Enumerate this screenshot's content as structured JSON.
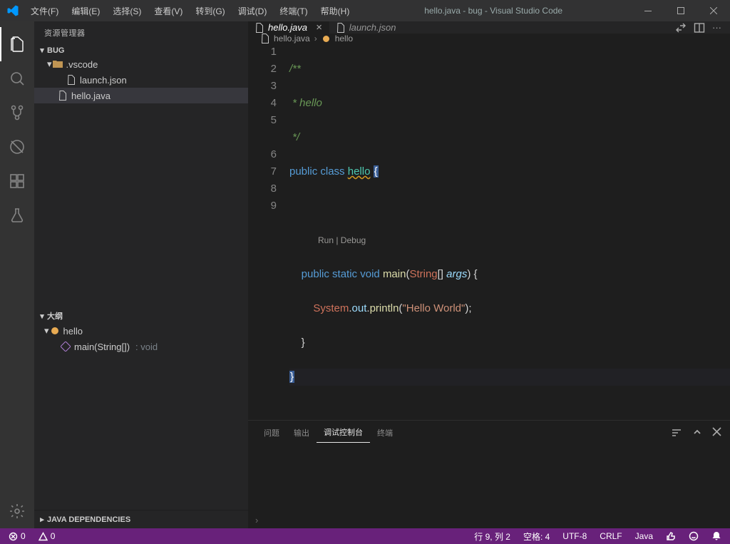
{
  "menu": [
    "文件(F)",
    "编辑(E)",
    "选择(S)",
    "查看(V)",
    "转到(G)",
    "调试(D)",
    "终端(T)",
    "帮助(H)"
  ],
  "title": "hello.java - bug - Visual Studio Code",
  "sidebar": {
    "title": "资源管理器",
    "project": "BUG",
    "folder": ".vscode",
    "files": [
      "launch.json",
      "hello.java"
    ],
    "outlineTitle": "大纲",
    "outlineClass": "hello",
    "outlineMethod": "main(String[])",
    "outlineReturn": ": void",
    "javaDeps": "JAVA DEPENDENCIES"
  },
  "tabs": [
    {
      "name": "hello.java",
      "active": true
    },
    {
      "name": "launch.json",
      "active": false
    }
  ],
  "breadcrumbs": {
    "file": "hello.java",
    "symbol": "hello"
  },
  "code": {
    "gutter": [
      "1",
      "2",
      "3",
      "4",
      "5",
      "",
      "6",
      "7",
      "8",
      "9"
    ],
    "l1": "/**",
    "l2": " * hello",
    "l3": " */",
    "l4_kw1": "public",
    "l4_kw2": "class",
    "l4_name": "hello",
    "l4_brace": "{",
    "codelens": "Run | Debug",
    "l6_kw1": "public",
    "l6_kw2": "static",
    "l6_kw3": "void",
    "l6_fn": "main",
    "l6_p": "(",
    "l6_type": "String",
    "l6_arr": "[]",
    "l6_arg": "args",
    "l6_cp": ")",
    "l6_brace": "{",
    "l7_sys": "System",
    "l7_dot1": ".",
    "l7_out": "out",
    "l7_dot2": ".",
    "l7_fn": "println",
    "l7_op": "(",
    "l7_str": "\"Hello World\"",
    "l7_cp": ")",
    "l7_semi": ";",
    "l8": "}",
    "l9": "}"
  },
  "panel": {
    "tabs": [
      "问题",
      "输出",
      "调试控制台",
      "终端"
    ],
    "active": 2
  },
  "status": {
    "errors": "0",
    "warnings": "0",
    "line": "行 9,  列 2",
    "spaces": "空格: 4",
    "encoding": "UTF-8",
    "eol": "CRLF",
    "lang": "Java"
  }
}
